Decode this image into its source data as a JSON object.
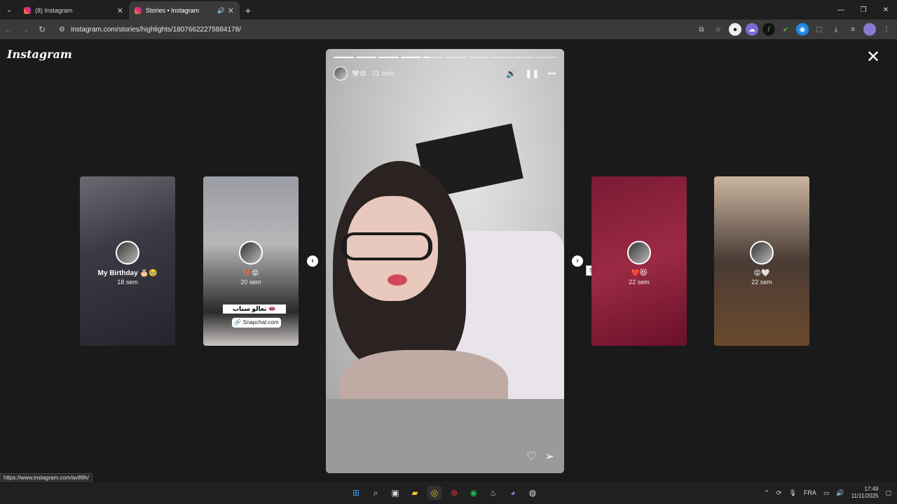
{
  "browser": {
    "tabs": [
      {
        "title": "(8) Instagram",
        "active": false
      },
      {
        "title": "Stories • Instagram",
        "active": true
      }
    ],
    "url": "instagram.com/stories/highlights/18076622275884178/",
    "status_url": "https://www.instagram.com/av89h/"
  },
  "page": {
    "logo": "Instagram",
    "close_symbol": "✕"
  },
  "main_story": {
    "emojis": "🤍😍",
    "time": "21 sem",
    "progress": {
      "segments": 10,
      "completed": 4,
      "current_fraction": 0.3
    }
  },
  "thumbnails": [
    {
      "label": "My Birthday 🎂🥹",
      "time": "18 sem"
    },
    {
      "label": "🤎😝",
      "time": "20 sem",
      "sticker_text": "تعالو سناب 👄",
      "link_text": "🔗 Snapchat.com"
    },
    {
      "label": "❤️😻",
      "time": "22 sem"
    },
    {
      "label": "😝🤍",
      "time": "22 sem"
    }
  ],
  "navigation": {
    "prev_symbol": "‹",
    "next_symbol": "›",
    "next_tooltip": "Suivant"
  },
  "taskbar": {
    "lang": "FRA",
    "time": "17:49",
    "date": "11/11/2025"
  }
}
